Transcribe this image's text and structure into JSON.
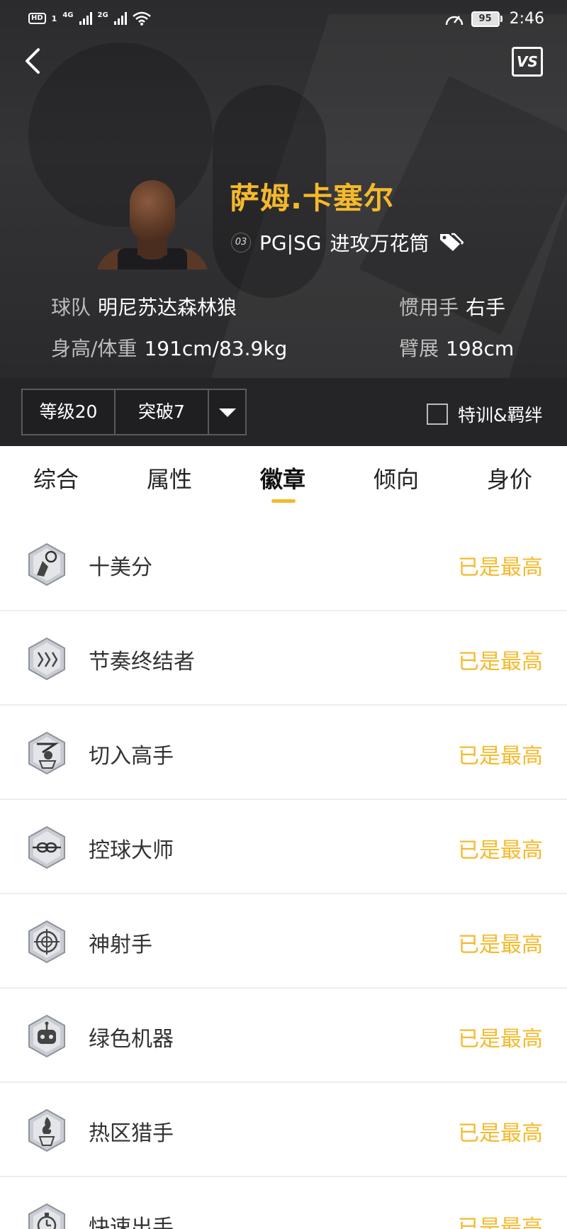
{
  "status_bar": {
    "hd_label": "HD",
    "sim1_label": "1",
    "net1": "4G",
    "net2": "2G",
    "battery": "95",
    "time": "2:46"
  },
  "header": {
    "vs_label": "VS",
    "player_name": "萨姆.卡塞尔",
    "jersey_number": "03",
    "positions": "PG|SG",
    "archetype": "进攻万花筒",
    "team_key": "球队",
    "team_value": "明尼苏达森林狼",
    "hand_key": "惯用手",
    "hand_value": "右手",
    "body_key": "身高/体重",
    "body_value": "191cm/83.9kg",
    "wingspan_key": "臂展",
    "wingspan_value": "198cm"
  },
  "level_bar": {
    "level": "等级20",
    "breakthrough": "突破7",
    "training_label": "特训&羁绊"
  },
  "tabs": [
    {
      "label": "综合"
    },
    {
      "label": "属性"
    },
    {
      "label": "徽章"
    },
    {
      "label": "倾向"
    },
    {
      "label": "身价"
    }
  ],
  "active_tab": "徽章",
  "badges": [
    {
      "name": "十美分",
      "status": "已是最高",
      "icon": "ten-cent-badge-icon"
    },
    {
      "name": "节奏终结者",
      "status": "已是最高",
      "icon": "rhythm-finisher-badge-icon"
    },
    {
      "name": "切入高手",
      "status": "已是最高",
      "icon": "slasher-badge-icon"
    },
    {
      "name": "控球大师",
      "status": "已是最高",
      "icon": "ball-handler-badge-icon"
    },
    {
      "name": "神射手",
      "status": "已是最高",
      "icon": "sharpshooter-badge-icon"
    },
    {
      "name": "绿色机器",
      "status": "已是最高",
      "icon": "green-machine-badge-icon"
    },
    {
      "name": "热区猎手",
      "status": "已是最高",
      "icon": "hot-zone-hunter-badge-icon"
    },
    {
      "name": "快速出手",
      "status": "已是最高",
      "icon": "quick-release-badge-icon"
    }
  ],
  "colors": {
    "accent": "#f5b92b",
    "header_bg": "#2b2b2d",
    "level_bar_bg": "#252528"
  }
}
